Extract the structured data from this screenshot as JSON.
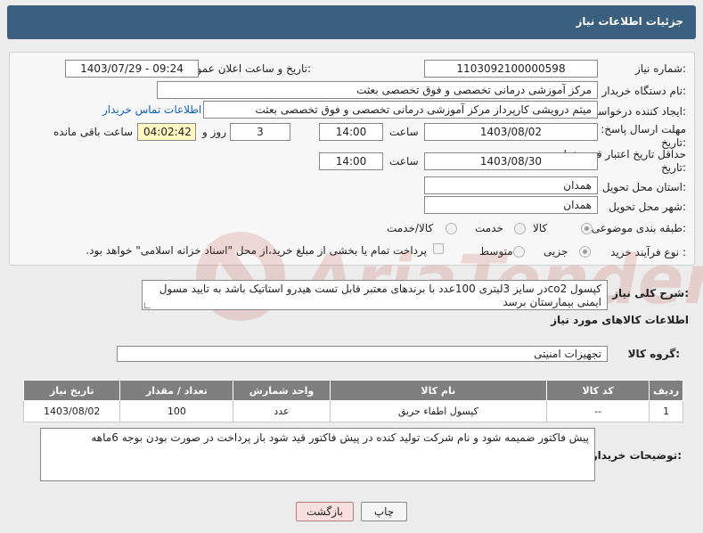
{
  "header": {
    "title": "جزئیات اطلاعات نیاز"
  },
  "form": {
    "need_number_label": "شماره نیاز:",
    "need_number": "1103092100000598",
    "announce_label": "تاریخ و ساعت اعلان عمومی:",
    "announce_value": "1403/07/29 - 09:24",
    "buyer_label": "نام دستگاه خریدار:",
    "buyer_value": "مرکز آموزشی درمانی تخصصی و فوق تخصصی بعثت",
    "creator_label": "ایجاد کننده درخواست:",
    "creator_value": "میثم درویشی کارپرداز مرکز آموزشی درمانی تخصصی و فوق تخصصی بعثت",
    "contact_link": "اطلاعات تماس خریدار",
    "deadline_label_1": "مهلت ارسال پاسخ: تا",
    "deadline_label_2": "تاریخ:",
    "deadline_date": "1403/08/02",
    "time_label": "ساعت",
    "deadline_time": "14:00",
    "days_value": "3",
    "days_label": "روز و",
    "remaining_value": "04:02:42",
    "remaining_label": "ساعت باقی مانده",
    "validity_label_1": "حداقل تاریخ اعتبار قیمت: تا",
    "validity_label_2": "تاریخ:",
    "validity_date": "1403/08/30",
    "validity_time": "14:00",
    "province_label": "استان محل تحویل:",
    "province_value": "همدان",
    "city_label": "شهر محل تحویل:",
    "city_value": "همدان",
    "category_label": "طبقه بندی موضوعی:",
    "category_options": [
      "کالا",
      "خدمت",
      "کالا/خدمت"
    ],
    "category_selected": "کالا",
    "process_label": "نوع فرآیند خرید :",
    "process_options": [
      "جزیی",
      "متوسط"
    ],
    "payment_note": "پرداخت تمام یا بخشی از مبلغ خرید،از محل \"اسناد خزانه اسلامی\" خواهد بود."
  },
  "summary": {
    "label": "شرح کلی نیاز:",
    "text": "کپسول co2در سایز 3لیتری  100عدد  با برندهای معتبر قابل تست هیدرو استاتیک باشد به تایید مسول ایمنی بیمارستان برسد"
  },
  "goods": {
    "section_title": "اطلاعات کالاهای مورد نیاز",
    "group_label": "گروه کالا:",
    "group_value": "تجهیزات امنیتی",
    "columns": [
      "ردیف",
      "کد کالا",
      "نام کالا",
      "واحد شمارش",
      "تعداد / مقدار",
      "تاریخ نیاز"
    ],
    "rows": [
      [
        "1",
        "--",
        "کپسول اطفاء حریق",
        "عدد",
        "100",
        "1403/08/02"
      ]
    ]
  },
  "notes": {
    "label": "توضیحات خریدار:",
    "text": "پیش فاکتور ضمیمه شود و نام شرکت تولید کنده در پیش فاکتور قید شود   باز پرداخت در صورت بودن بوجه 6ماهه"
  },
  "buttons": {
    "print": "چاپ",
    "back": "بازگشت"
  },
  "colors": {
    "header_bg": "#3b5f7f",
    "table_header_bg": "#7f7f7f",
    "highlight": "#fff7c2"
  }
}
